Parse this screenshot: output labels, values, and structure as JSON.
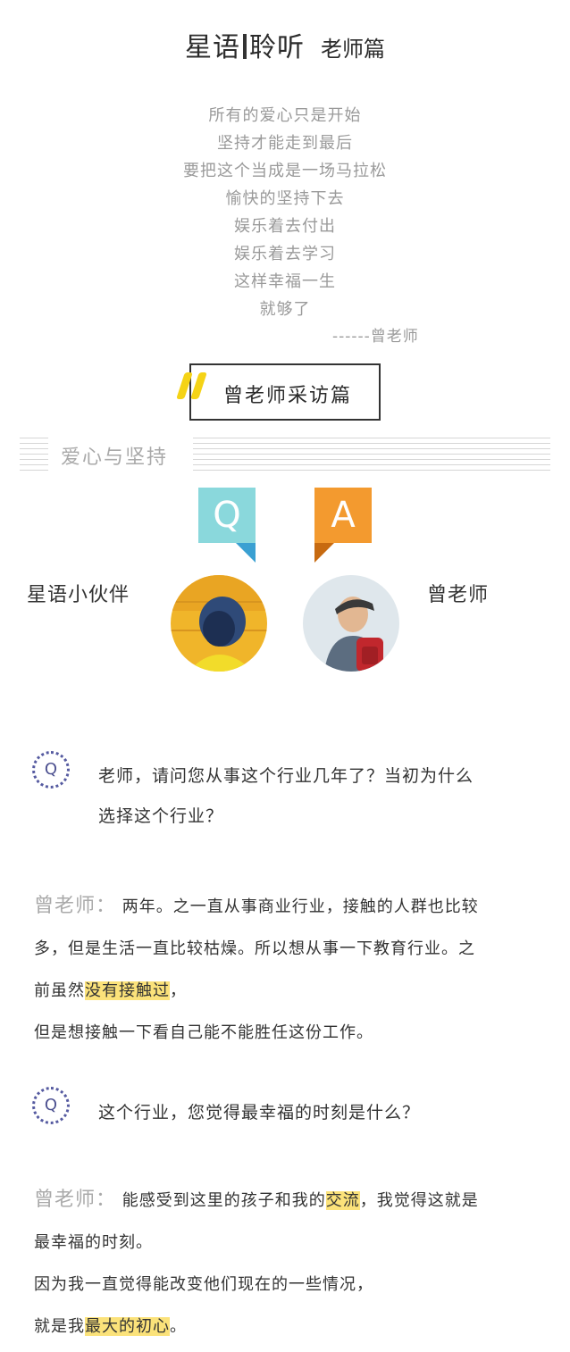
{
  "header": {
    "title_left": "星语",
    "title_right": "聆听",
    "subtitle": "老师篇"
  },
  "poem": {
    "lines": [
      "所有的爱心只是开始",
      "坚持才能走到最后",
      "要把这个当成是一场马拉松",
      "愉快的坚持下去",
      "娱乐着去付出",
      "娱乐着去学习",
      "这样幸福一生",
      "就够了"
    ],
    "signature": "------曾老师"
  },
  "interview": {
    "title": "曾老师采访篇"
  },
  "section": {
    "title": "爱心与坚持"
  },
  "qa": {
    "q_letter": "Q",
    "a_letter": "A",
    "q_color": "#8ad8dc",
    "q_tail_color": "#3aa0d2",
    "a_color": "#f39a2f",
    "a_tail_color": "#c76a10",
    "q_role": "星语小伙伴",
    "a_role": "曾老师"
  },
  "items": [
    {
      "icon": "Q",
      "question_line1": "老师，请问您从事这个行业几年了？当初为什么",
      "question_line2": "选择这个行业？",
      "answer_name": "曾老师：",
      "answer_p1": "两年。之一直从事商业行业，接触的人群也比较",
      "answer_p2": "多，但是生活一直比较枯燥。所以想从事一下教育行业。之",
      "answer_p3_pre": "前虽然",
      "answer_p3_hl": "没有接触过",
      "answer_p3_post": "，",
      "answer_p4": "但是想接触一下看自己能不能胜任这份工作。"
    },
    {
      "icon": "Q",
      "question_line1": "这个行业，您觉得最幸福的时刻是什么？",
      "answer_name": "曾老师：",
      "answer_p1_pre": "能感受到这里的孩子和我的",
      "answer_p1_hl": "交流",
      "answer_p1_post": "，我觉得这就是",
      "answer_p2": "最幸福的时刻。",
      "answer_p3": "因为我一直觉得能改变他们现在的一些情况，",
      "answer_p4_pre": "就是我",
      "answer_p4_hl": "最大的初心",
      "answer_p4_post": "。"
    }
  ]
}
